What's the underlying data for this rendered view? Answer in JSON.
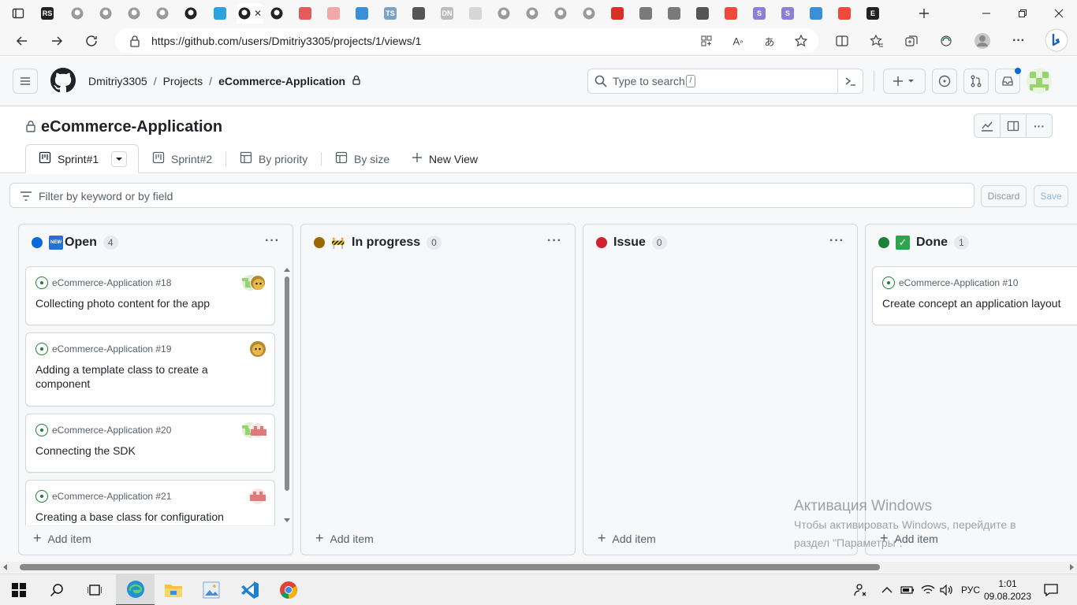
{
  "browser": {
    "tabs": [
      {
        "icon": "rs-icon",
        "label": "RS",
        "color": "#222222"
      },
      {
        "icon": "github-icon",
        "label": "",
        "color": "#9a9a9a"
      },
      {
        "icon": "github-icon",
        "label": "",
        "color": "#9a9a9a"
      },
      {
        "icon": "github-icon",
        "label": "",
        "color": "#9a9a9a"
      },
      {
        "icon": "github-icon",
        "label": "",
        "color": "#9a9a9a"
      },
      {
        "icon": "github-icon",
        "label": "",
        "color": "#222222"
      },
      {
        "icon": "telegram-icon",
        "label": "",
        "color": "#2aa3df"
      },
      {
        "icon": "github-icon",
        "label": "",
        "color": "#222222"
      },
      {
        "icon": "github-icon",
        "label": "",
        "color": "#222222"
      },
      {
        "icon": "lips-icon",
        "label": "",
        "color": "#e35b5b"
      },
      {
        "icon": "yandex-icon",
        "label": "",
        "color": "#f4a7a7"
      },
      {
        "icon": "puzzle-icon",
        "label": "",
        "color": "#3b8fd9"
      },
      {
        "icon": "ts-icon",
        "label": "TS",
        "color": "#7ba3c9"
      },
      {
        "icon": "account-icon",
        "label": "",
        "color": "#555555"
      },
      {
        "icon": "dn-icon",
        "label": "DN",
        "color": "#bdbdbd"
      },
      {
        "icon": "circle-icon",
        "label": "",
        "color": "#d6d6d6"
      },
      {
        "icon": "github-icon",
        "label": "",
        "color": "#9a9a9a"
      },
      {
        "icon": "github-icon",
        "label": "",
        "color": "#9a9a9a"
      },
      {
        "icon": "github-icon",
        "label": "",
        "color": "#9a9a9a"
      },
      {
        "icon": "github-icon",
        "label": "",
        "color": "#9a9a9a"
      },
      {
        "icon": "chrome-red-icon",
        "label": "",
        "color": "#d93025"
      },
      {
        "icon": "y-icon",
        "label": "",
        "color": "#7a7a7a"
      },
      {
        "icon": "y-icon",
        "label": "",
        "color": "#7a7a7a"
      },
      {
        "icon": "pen-icon",
        "label": "",
        "color": "#555555"
      },
      {
        "icon": "yandex-icon",
        "label": "",
        "color": "#f04a3a"
      },
      {
        "icon": "s-icon",
        "label": "S",
        "color": "#8b7fd9"
      },
      {
        "icon": "s-icon",
        "label": "S",
        "color": "#8b7fd9"
      },
      {
        "icon": "puzzle-icon",
        "label": "",
        "color": "#3b8fd9"
      },
      {
        "icon": "yandex-icon",
        "label": "",
        "color": "#f04a3a"
      },
      {
        "icon": "e-icon",
        "label": "E",
        "color": "#222222"
      }
    ],
    "url": "https://github.com/users/Dmitriy3305/projects/1/views/1"
  },
  "github": {
    "breadcrumb": [
      "Dmitriy3305",
      "/",
      "Projects",
      "/",
      "eCommerce-Application"
    ],
    "search_placeholder": "Type to search",
    "search_shortcut": "/",
    "create_plus": "+"
  },
  "project": {
    "title": "eCommerce-Application",
    "views": [
      "Sprint#1",
      "Sprint#2",
      "By priority",
      "By size"
    ],
    "new_view": "New View",
    "filter_placeholder": "Filter by keyword or by field",
    "discard": "Discard",
    "save": "Save"
  },
  "columns": [
    {
      "name": "Open",
      "count": "4",
      "dot_color": "#0969da",
      "emoji": "NEW",
      "emoji_color": "#2a6fd6",
      "add_item": "Add item",
      "cards": [
        {
          "ref": "eCommerce-Application #18",
          "title": "Collecting photo content for the app"
        },
        {
          "ref": "eCommerce-Application #19",
          "title": "Adding a template class to create a component"
        },
        {
          "ref": "eCommerce-Application #20",
          "title": "Connecting the SDK"
        },
        {
          "ref": "eCommerce-Application #21",
          "title": "Creating a base class for configuration"
        }
      ]
    },
    {
      "name": "In progress",
      "count": "0",
      "dot_color": "#9a6700",
      "emoji": "🚧",
      "emoji_color": "#ffffff",
      "add_item": "Add item",
      "cards": []
    },
    {
      "name": "Issue",
      "count": "0",
      "dot_color": "#cf222e",
      "emoji": "",
      "emoji_color": "",
      "add_item": "Add item",
      "cards": []
    },
    {
      "name": "Done",
      "count": "1",
      "dot_color": "#1a7f37",
      "emoji": "✓",
      "emoji_color": "#2da44e",
      "add_item": "Add item",
      "cards": [
        {
          "ref": "eCommerce-Application #10",
          "title": "Create concept an application layout"
        }
      ]
    }
  ],
  "watermark": {
    "line1": "Активация Windows",
    "line2": "Чтобы активировать Windows, перейдите в",
    "line3": "раздел \"Параметры\"."
  },
  "taskbar": {
    "language": "РУС",
    "time": "1:01",
    "date": "09.08.2023"
  }
}
